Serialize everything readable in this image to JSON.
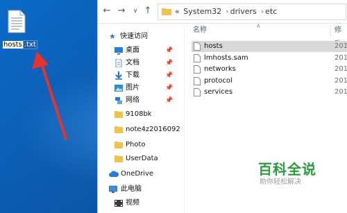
{
  "desktop": {
    "file_name": "hosts",
    "file_ext": ".txt"
  },
  "address_bar": {
    "overflow": "«",
    "crumbs": [
      "System32",
      "drivers",
      "etc"
    ]
  },
  "nav_pane": {
    "quick_access": "快速访问",
    "items": [
      {
        "label": "桌面",
        "pinned": true
      },
      {
        "label": "文档",
        "pinned": true
      },
      {
        "label": "下载",
        "pinned": true
      },
      {
        "label": "图片",
        "pinned": true
      },
      {
        "label": "网络",
        "pinned": true
      },
      {
        "label": "9108bk",
        "pinned": false
      },
      {
        "label": "note4z2016092",
        "pinned": false
      },
      {
        "label": "Photo",
        "pinned": false
      },
      {
        "label": "UserData",
        "pinned": false
      }
    ],
    "onedrive": "OneDrive",
    "this_pc": "此电脑",
    "video": "视频",
    "pin_symbol": "📌"
  },
  "content": {
    "col_name": "名称",
    "col_modified": "修改",
    "files": [
      {
        "name": "hosts",
        "date": "201"
      },
      {
        "name": "lmhosts.sam",
        "date": "201"
      },
      {
        "name": "networks",
        "date": "201"
      },
      {
        "name": "protocol",
        "date": "201"
      },
      {
        "name": "services",
        "date": "201"
      }
    ]
  },
  "watermark": {
    "title": "百科全说",
    "subtitle": "助你轻松解决"
  },
  "colors": {
    "desktop_blue": "#0a58ad",
    "folder_yellow": "#f1c24a",
    "arrow_red": "#e8332d",
    "watermark_green": "#2a9a3d"
  }
}
